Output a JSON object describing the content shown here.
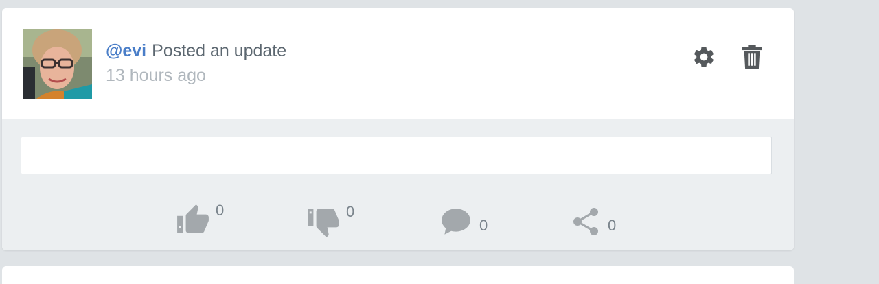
{
  "post": {
    "author_handle": "@evi",
    "action_text": "Posted an update",
    "timestamp": "13 hours ago",
    "content": ""
  },
  "header_actions": {
    "settings_icon": "gear-icon",
    "delete_icon": "trash-icon"
  },
  "comment_box": {
    "value": "",
    "placeholder": ""
  },
  "reactions": {
    "likes": "0",
    "dislikes": "0",
    "comments": "0",
    "shares": "0"
  },
  "colors": {
    "link": "#4a7ec8",
    "icon": "#a3a8ac",
    "action_icon": "#55595c",
    "page_bg": "#dfe3e6",
    "body_bg": "#eceff1"
  }
}
